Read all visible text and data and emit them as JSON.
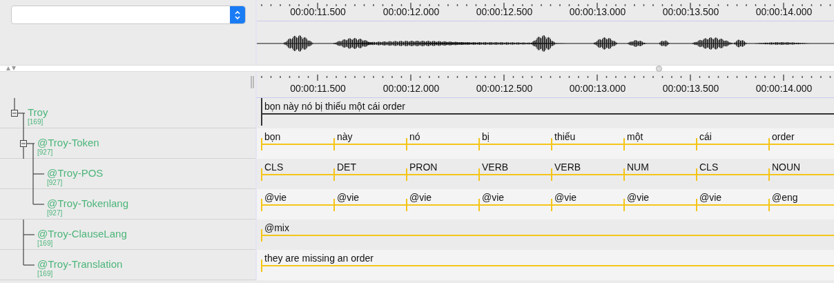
{
  "top_ruler": {
    "labels": [
      "00:00:11.500",
      "00:00:12.000",
      "00:00:12.500",
      "00:00:13.000",
      "00:00:13.500",
      "00:00:14.000"
    ]
  },
  "bottom_ruler": {
    "labels": [
      "00:00:11.500",
      "00:00:12.000",
      "00:00:12.500",
      "00:00:13.000",
      "00:00:13.500",
      "00:00:14.000"
    ]
  },
  "tiers": [
    {
      "name": "Troy",
      "count": "[169]",
      "expanded": true,
      "active": true,
      "annotations": [
        "bọn này nó bị thiếu một cái order"
      ],
      "children": [
        {
          "name": "@Troy-Token",
          "count": "[927]",
          "expanded": true,
          "active": false,
          "annotations": [
            "bọn",
            "này",
            "nó",
            "bị",
            "thiếu",
            "một",
            "cái",
            "order"
          ],
          "children": [
            {
              "name": "@Troy-POS",
              "count": "[927]",
              "active": false,
              "annotations": [
                "CLS",
                "DET",
                "PRON",
                "VERB",
                "VERB",
                "NUM",
                "CLS",
                "NOUN"
              ]
            },
            {
              "name": "@Troy-Tokenlang",
              "count": "[927]",
              "active": false,
              "annotations": [
                "@vie",
                "@vie",
                "@vie",
                "@vie",
                "@vie",
                "@vie",
                "@vie",
                "@eng"
              ]
            }
          ]
        },
        {
          "name": "@Troy-ClauseLang",
          "count": "[169]",
          "active": false,
          "annotations": [
            "@mix"
          ]
        },
        {
          "name": "@Troy-Translation",
          "count": "[169]",
          "active": false,
          "annotations": [
            "they are missing an order"
          ]
        }
      ]
    }
  ]
}
